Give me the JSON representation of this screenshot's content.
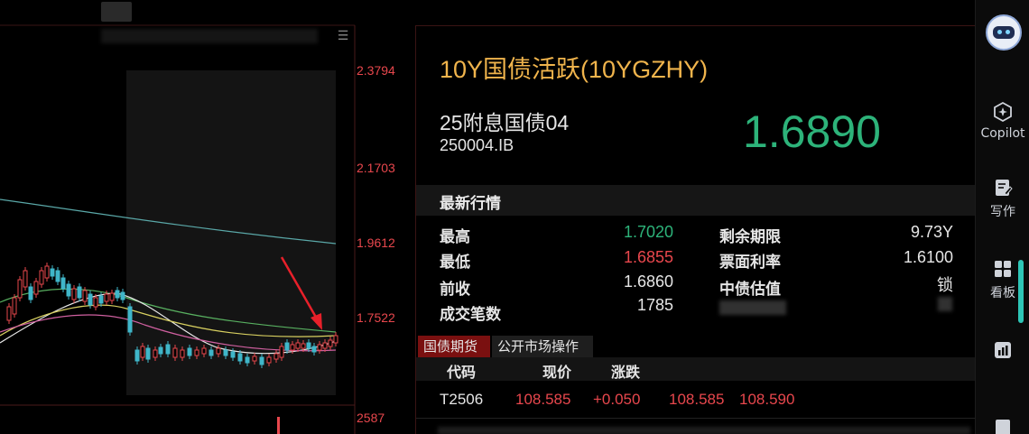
{
  "chart": {
    "axis_labels": [
      "2.3794",
      "2.1703",
      "1.9612",
      "1.7522",
      "2587"
    ],
    "colors": {
      "up": "#e8474d",
      "down": "#3fb6c9",
      "ma_long": "#5aa8a8",
      "ma_white": "#e8e8e8",
      "ma_yellow": "#d8d060",
      "ma_green": "#58b060",
      "ma_pink": "#d060a0"
    }
  },
  "quote": {
    "title": "10Y国债活跃(10YGZHY)",
    "bond_name": "25附息国债04",
    "bond_code": "250004.IB",
    "price": "1.6890"
  },
  "market": {
    "section_title": "最新行情",
    "left": [
      {
        "label": "最高",
        "value": "1.7020",
        "tone": "green"
      },
      {
        "label": "最低",
        "value": "1.6855",
        "tone": "red"
      },
      {
        "label": "前收",
        "value": "1.6860",
        "tone": "white"
      },
      {
        "label": "成交笔数",
        "value": "1785",
        "tone": "white"
      }
    ],
    "right": [
      {
        "label": "剩余期限",
        "value": "9.73Y"
      },
      {
        "label": "票面利率",
        "value": "1.6100"
      },
      {
        "label": "中债估值",
        "value": "锁"
      }
    ]
  },
  "tabs": {
    "active": "国债期货",
    "inactive": "公开市场操作"
  },
  "table": {
    "headers": [
      "代码",
      "现价",
      "涨跌"
    ],
    "rows": [
      {
        "code": "T2506",
        "price": "108.585",
        "change": "+0.050",
        "bid": "108.585",
        "ask": "108.590"
      }
    ]
  },
  "toolbar": {
    "copilot": "Copilot",
    "write": "写作",
    "board": "看板"
  }
}
